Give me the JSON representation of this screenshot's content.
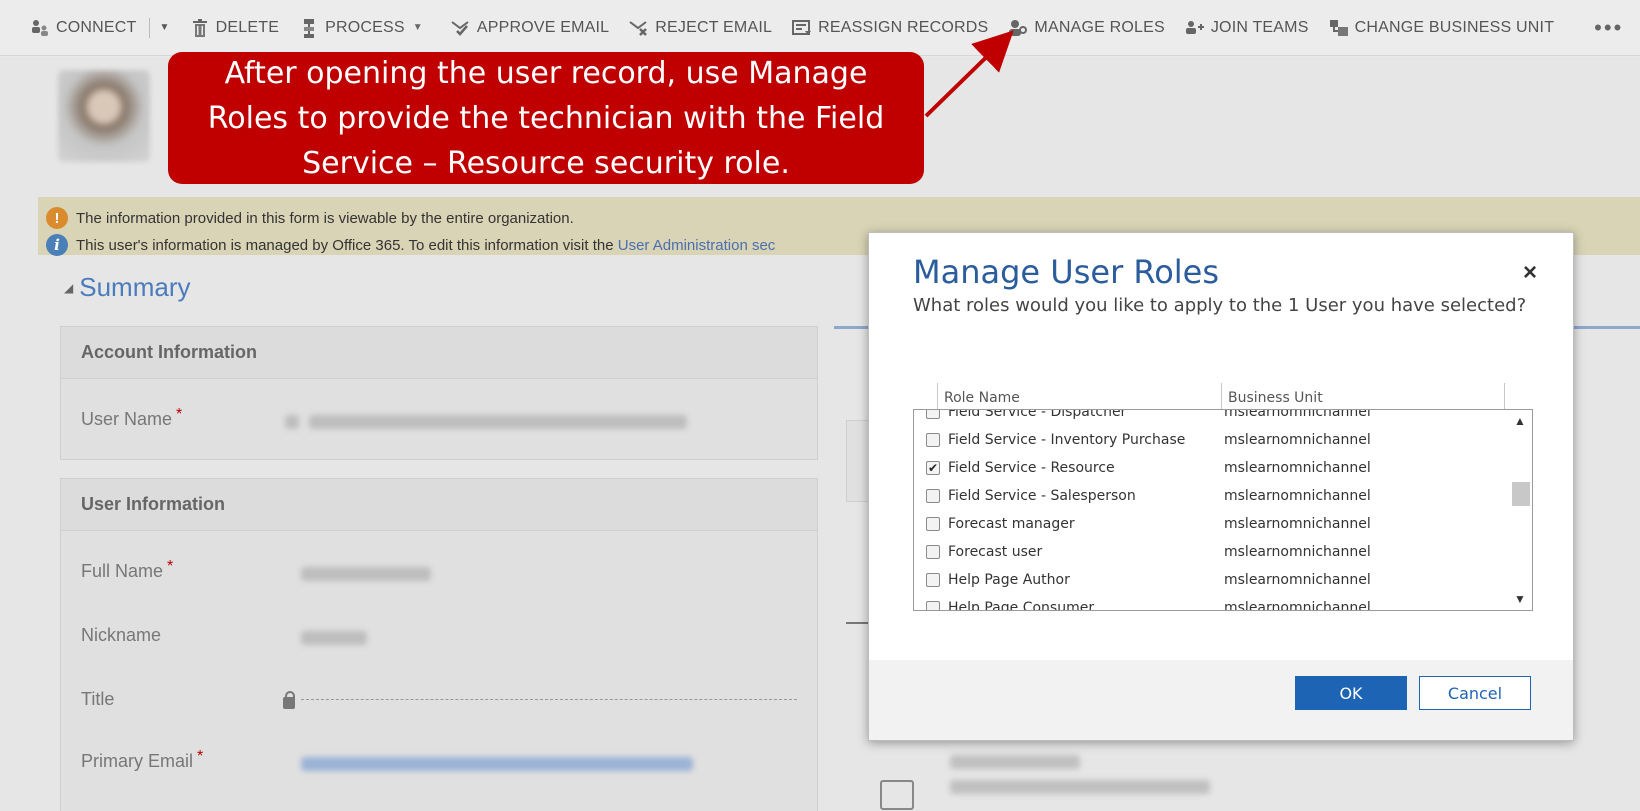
{
  "commandbar": {
    "items": [
      {
        "label": "CONNECT",
        "icon": "connect-icon"
      },
      {
        "label": "DELETE",
        "icon": "trash-icon"
      },
      {
        "label": "PROCESS",
        "icon": "process-icon"
      },
      {
        "label": "APPROVE EMAIL",
        "icon": "approve-email-icon"
      },
      {
        "label": "REJECT EMAIL",
        "icon": "reject-email-icon"
      },
      {
        "label": "REASSIGN RECORDS",
        "icon": "reassign-icon"
      },
      {
        "label": "MANAGE ROLES",
        "icon": "manage-roles-icon"
      },
      {
        "label": "JOIN TEAMS",
        "icon": "join-teams-icon"
      },
      {
        "label": "CHANGE BUSINESS UNIT",
        "icon": "business-unit-icon"
      }
    ],
    "more": "•••"
  },
  "callout": {
    "text": "After opening the user record, use Manage Roles to provide the technician with the Field Service – Resource security role.",
    "color": "#c00000"
  },
  "notices": {
    "line1": "The information provided in this form is viewable by the entire organization.",
    "line2_prefix": "This user's information is managed by Office 365. To edit this information visit the ",
    "line2_link": "User Administration sec"
  },
  "form": {
    "summary_title": "Summary",
    "account_section": "Account Information",
    "user_name_label": "User Name",
    "user_section": "User Information",
    "full_name_label": "Full Name",
    "nickname_label": "Nickname",
    "title_label": "Title",
    "primary_email_label": "Primary Email",
    "required_mark": "*"
  },
  "dialog": {
    "title": "Manage User Roles",
    "subtitle": "What roles would you like to apply to the 1 User you have selected?",
    "close": "×",
    "columns": [
      "Role Name",
      "Business Unit"
    ],
    "rows": [
      {
        "role": "Field Service - Dispatcher",
        "bu": "mslearnomnichannel",
        "checked": false
      },
      {
        "role": "Field Service - Inventory Purchase",
        "bu": "mslearnomnichannel",
        "checked": false
      },
      {
        "role": "Field Service - Resource",
        "bu": "mslearnomnichannel",
        "checked": true
      },
      {
        "role": "Field Service - Salesperson",
        "bu": "mslearnomnichannel",
        "checked": false
      },
      {
        "role": "Forecast manager",
        "bu": "mslearnomnichannel",
        "checked": false
      },
      {
        "role": "Forecast user",
        "bu": "mslearnomnichannel",
        "checked": false
      },
      {
        "role": "Help Page Author",
        "bu": "mslearnomnichannel",
        "checked": false
      },
      {
        "role": "Help Page Consumer",
        "bu": "mslearnomnichannel",
        "checked": false
      }
    ],
    "ok_label": "OK",
    "cancel_label": "Cancel",
    "accent": "#1e64b4"
  }
}
